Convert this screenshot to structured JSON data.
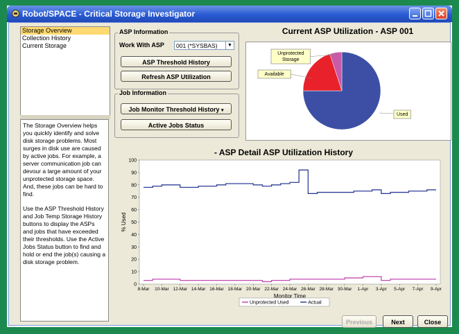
{
  "window": {
    "title": "Robot/SPACE - Critical Storage Investigator"
  },
  "nav": {
    "items": [
      "Storage Overview",
      "Collection History",
      "Current Storage"
    ],
    "selected": 0
  },
  "help": {
    "paragraphs": [
      "The Storage Overview helps you quickly identify and solve disk storage problems. Most surges in disk use are caused by active jobs. For example, a server communication job can devour a large amount of your unprotected storage space. And, these jobs can be hard to find.",
      "Use the ASP Threshold History and Job Temp Storage History buttons to display the ASPs and jobs that have exceeded their thresholds. Use the Active Jobs Status button to find and hold or end the job(s) causing a disk storage problem."
    ]
  },
  "asp_info": {
    "group_label": "ASP Information",
    "work_with_label": "Work With ASP",
    "selected_asp": "001 (*SYSBAS)",
    "threshold_button": "ASP Threshold History",
    "refresh_button": "Refresh ASP Utilization"
  },
  "job_info": {
    "group_label": "Job Information",
    "monitor_button": "Job Monitor Threshold History",
    "active_jobs_button": "Active Jobs Status"
  },
  "footer": {
    "previous": "Previous",
    "next": "Next",
    "close": "Close"
  },
  "chart_data": [
    {
      "type": "pie",
      "title": "Current ASP Utilization - ASP 001",
      "labels": [
        "Used",
        "Available",
        "Unprotected Storage"
      ],
      "values": [
        75,
        20,
        5
      ],
      "colors": [
        "#3c4fa5",
        "#e8212b",
        "#c85aa8"
      ]
    },
    {
      "type": "line",
      "title": "- ASP Detail ASP Utilization History",
      "xlabel": "Monitor Time",
      "ylabel": "% Used",
      "ylim": [
        0,
        100
      ],
      "yticks": [
        0,
        10,
        20,
        30,
        40,
        50,
        60,
        70,
        80,
        90,
        100
      ],
      "xticks": [
        "8-Mar",
        "10-Mar",
        "12-Mar",
        "14-Mar",
        "16-Mar",
        "18-Mar",
        "20-Mar",
        "22-Mar",
        "24-Mar",
        "26-Mar",
        "28-Mar",
        "30-Mar",
        "1-Apr",
        "3-Apr",
        "5-Apr",
        "7-Apr",
        "9-Apr"
      ],
      "x": [
        0,
        1,
        2,
        3,
        4,
        5,
        6,
        7,
        8,
        9,
        10,
        11,
        12,
        13,
        14,
        15,
        16,
        17,
        18,
        19,
        20,
        21,
        22,
        23,
        24,
        25,
        26,
        27,
        28,
        29,
        30,
        31,
        32
      ],
      "series": [
        {
          "name": "Unprotected Used",
          "color": "#c04ab0",
          "values": [
            3,
            4,
            4,
            4,
            3,
            3,
            3,
            3,
            3,
            3,
            3,
            3,
            3,
            2,
            3,
            3,
            4,
            4,
            4,
            4,
            4,
            4,
            5,
            5,
            6,
            6,
            3,
            4,
            4,
            4,
            4,
            4,
            4
          ]
        },
        {
          "name": "Actual",
          "color": "#2d3f96",
          "values": [
            78,
            79,
            80,
            80,
            78,
            78,
            79,
            79,
            80,
            81,
            81,
            81,
            80,
            79,
            80,
            81,
            82,
            92,
            73,
            74,
            74,
            74,
            74,
            75,
            75,
            76,
            73,
            74,
            74,
            75,
            75,
            76,
            76
          ]
        }
      ],
      "legend": "bottom"
    }
  ]
}
